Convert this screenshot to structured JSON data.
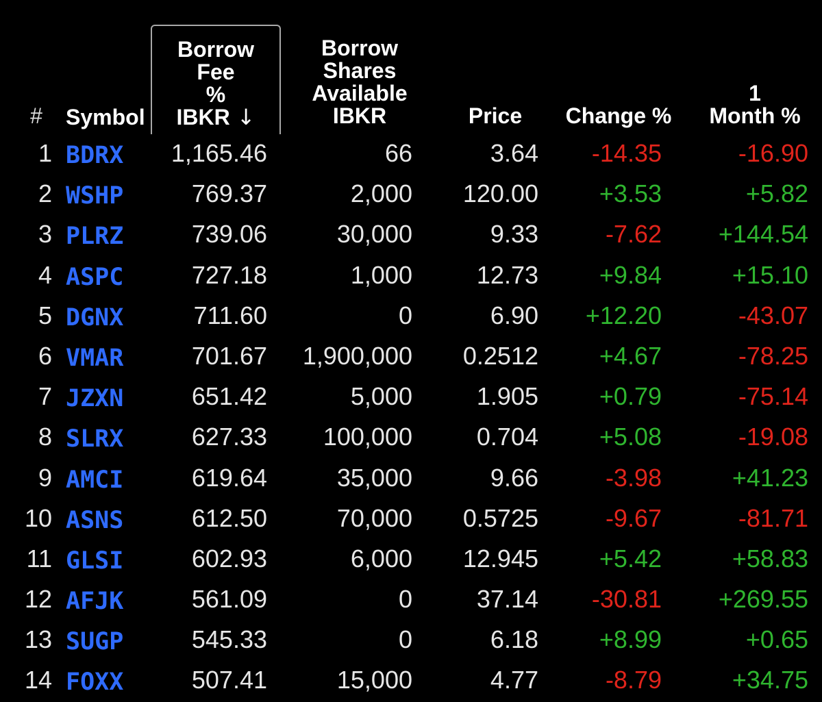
{
  "header": {
    "num": "#",
    "symbol": "Symbol",
    "fee_lines": [
      "Borrow",
      "Fee",
      "%",
      "IBKR"
    ],
    "fee_sort_icon": "sort-down-arrow-icon",
    "fee_sort_glyph": "↓",
    "shares_lines": [
      "Borrow",
      "Shares",
      "Available",
      "IBKR"
    ],
    "price": "Price",
    "change": "Change %",
    "month_lines": [
      "1",
      "Month %"
    ]
  },
  "colors": {
    "symbol": "#2f6bff",
    "negative": "#e0241b",
    "positive": "#2fb52f",
    "background": "#000000"
  },
  "rows": [
    {
      "num": "1",
      "symbol": "BDRX",
      "fee": "1,165.46",
      "shares": "66",
      "price": "3.64",
      "change": "-14.35",
      "month": "-16.90"
    },
    {
      "num": "2",
      "symbol": "WSHP",
      "fee": "769.37",
      "shares": "2,000",
      "price": "120.00",
      "change": "+3.53",
      "month": "+5.82"
    },
    {
      "num": "3",
      "symbol": "PLRZ",
      "fee": "739.06",
      "shares": "30,000",
      "price": "9.33",
      "change": "-7.62",
      "month": "+144.54"
    },
    {
      "num": "4",
      "symbol": "ASPC",
      "fee": "727.18",
      "shares": "1,000",
      "price": "12.73",
      "change": "+9.84",
      "month": "+15.10"
    },
    {
      "num": "5",
      "symbol": "DGNX",
      "fee": "711.60",
      "shares": "0",
      "price": "6.90",
      "change": "+12.20",
      "month": "-43.07"
    },
    {
      "num": "6",
      "symbol": "VMAR",
      "fee": "701.67",
      "shares": "1,900,000",
      "price": "0.2512",
      "change": "+4.67",
      "month": "-78.25"
    },
    {
      "num": "7",
      "symbol": "JZXN",
      "fee": "651.42",
      "shares": "5,000",
      "price": "1.905",
      "change": "+0.79",
      "month": "-75.14"
    },
    {
      "num": "8",
      "symbol": "SLRX",
      "fee": "627.33",
      "shares": "100,000",
      "price": "0.704",
      "change": "+5.08",
      "month": "-19.08"
    },
    {
      "num": "9",
      "symbol": "AMCI",
      "fee": "619.64",
      "shares": "35,000",
      "price": "9.66",
      "change": "-3.98",
      "month": "+41.23"
    },
    {
      "num": "10",
      "symbol": "ASNS",
      "fee": "612.50",
      "shares": "70,000",
      "price": "0.5725",
      "change": "-9.67",
      "month": "-81.71"
    },
    {
      "num": "11",
      "symbol": "GLSI",
      "fee": "602.93",
      "shares": "6,000",
      "price": "12.945",
      "change": "+5.42",
      "month": "+58.83"
    },
    {
      "num": "12",
      "symbol": "AFJK",
      "fee": "561.09",
      "shares": "0",
      "price": "37.14",
      "change": "-30.81",
      "month": "+269.55"
    },
    {
      "num": "13",
      "symbol": "SUGP",
      "fee": "545.33",
      "shares": "0",
      "price": "6.18",
      "change": "+8.99",
      "month": "+0.65"
    },
    {
      "num": "14",
      "symbol": "FOXX",
      "fee": "507.41",
      "shares": "15,000",
      "price": "4.77",
      "change": "-8.79",
      "month": "+34.75"
    }
  ]
}
